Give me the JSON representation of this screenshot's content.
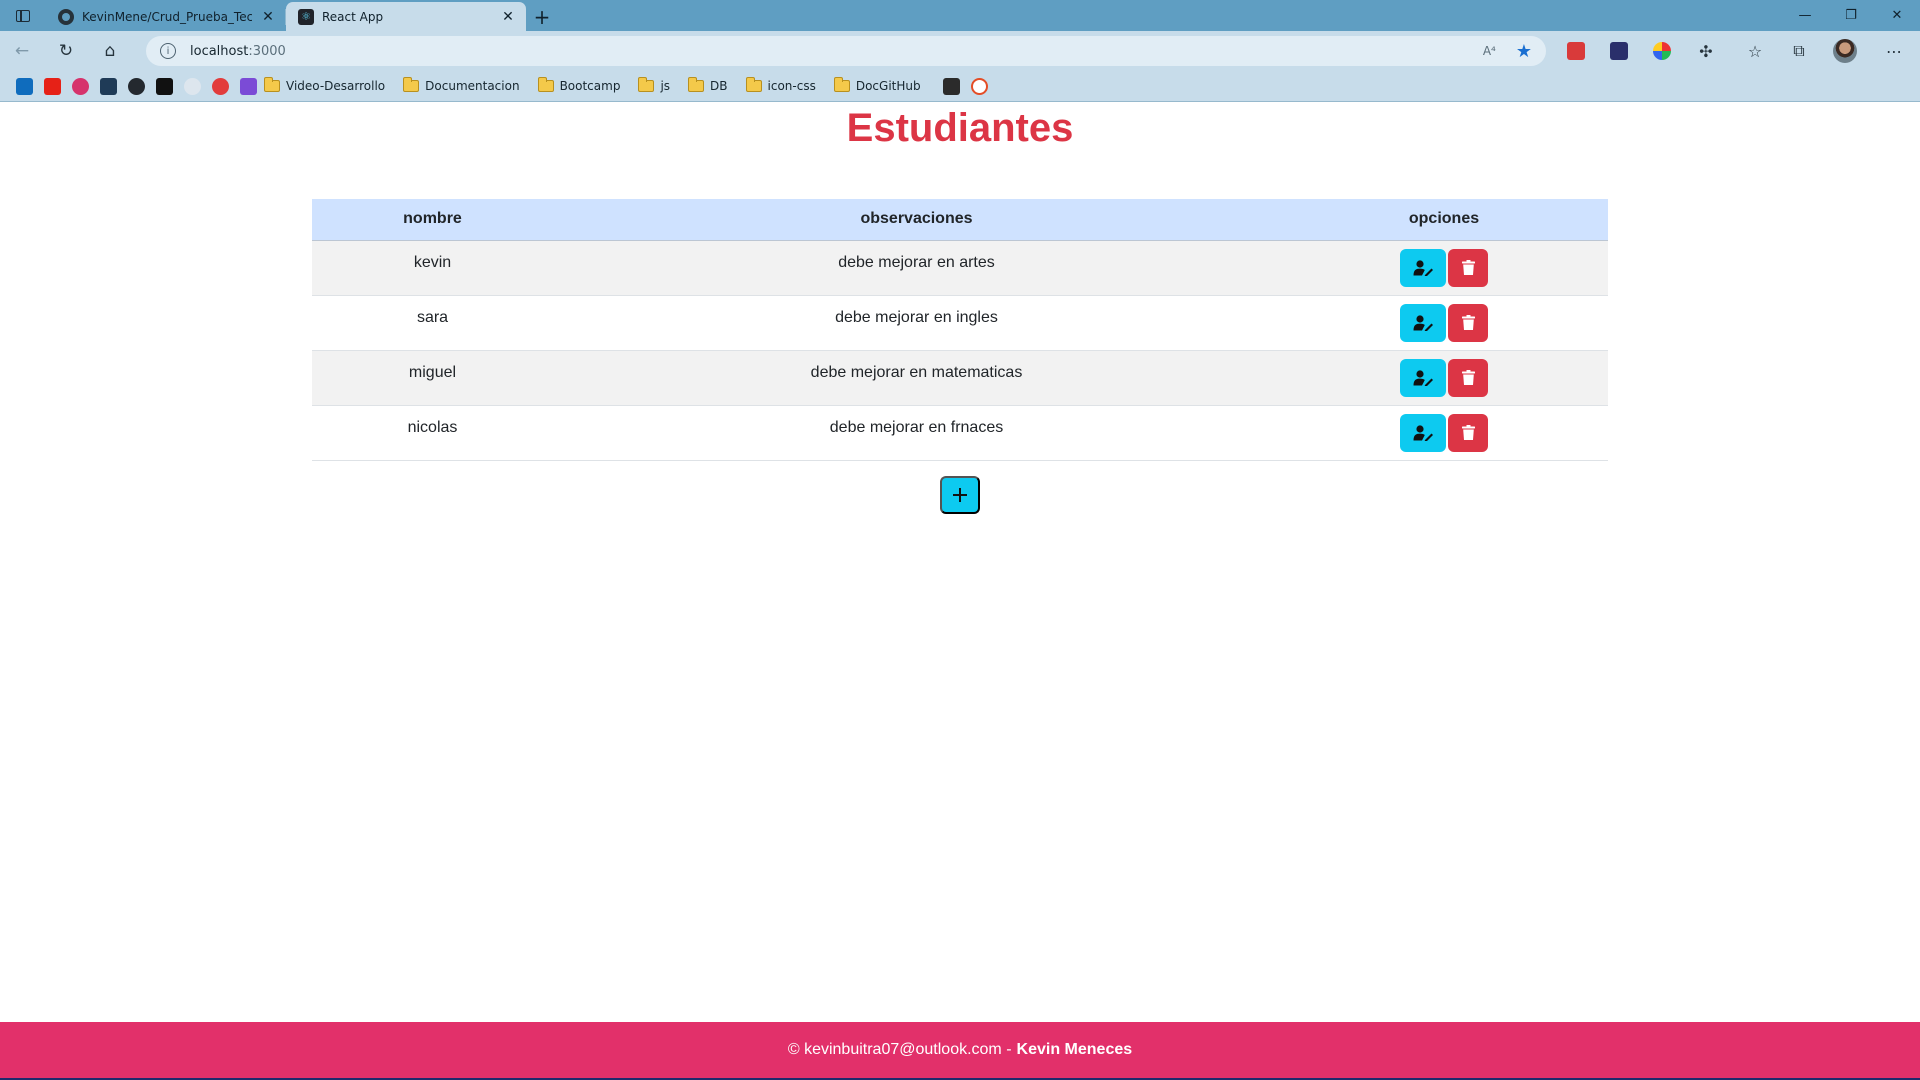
{
  "browser": {
    "tabs": [
      {
        "title": "KevinMene/Crud_Prueba_Tecnica",
        "icon": "github-icon",
        "active": false
      },
      {
        "title": "React App",
        "icon": "react-icon",
        "active": true
      }
    ],
    "new_tab_label": "+",
    "url_host": "localhost",
    "url_port": ":3000",
    "read_aloud_label": "A⁴",
    "bookmarks": [
      "Video-Desarrollo",
      "Documentacion",
      "Bootcamp",
      "js",
      "DB",
      "icon-css",
      "DocGitHub"
    ],
    "colors": {
      "frame": "#5f9ec2",
      "toolbar": "#c7dcea"
    }
  },
  "page": {
    "title": "Estudiantes",
    "table": {
      "headers": [
        "nombre",
        "observaciones",
        "opciones"
      ],
      "rows": [
        {
          "nombre": "kevin",
          "observaciones": "debe mejorar en artes"
        },
        {
          "nombre": "sara",
          "observaciones": "debe mejorar en ingles"
        },
        {
          "nombre": "miguel",
          "observaciones": "debe mejorar en matematicas"
        },
        {
          "nombre": "nicolas",
          "observaciones": "debe mejorar en frnaces"
        }
      ]
    },
    "edit_icon": "user-edit-icon",
    "delete_icon": "trash-icon",
    "add_icon": "plus-icon",
    "colors": {
      "title": "#dc3545",
      "edit": "#0dcaf0",
      "delete": "#dc3545",
      "header_bg": "#cfe2ff"
    }
  },
  "footer": {
    "email": "© kevinbuitra07@outlook.com -",
    "name": "Kevin Meneces",
    "color": "#e2306a"
  }
}
